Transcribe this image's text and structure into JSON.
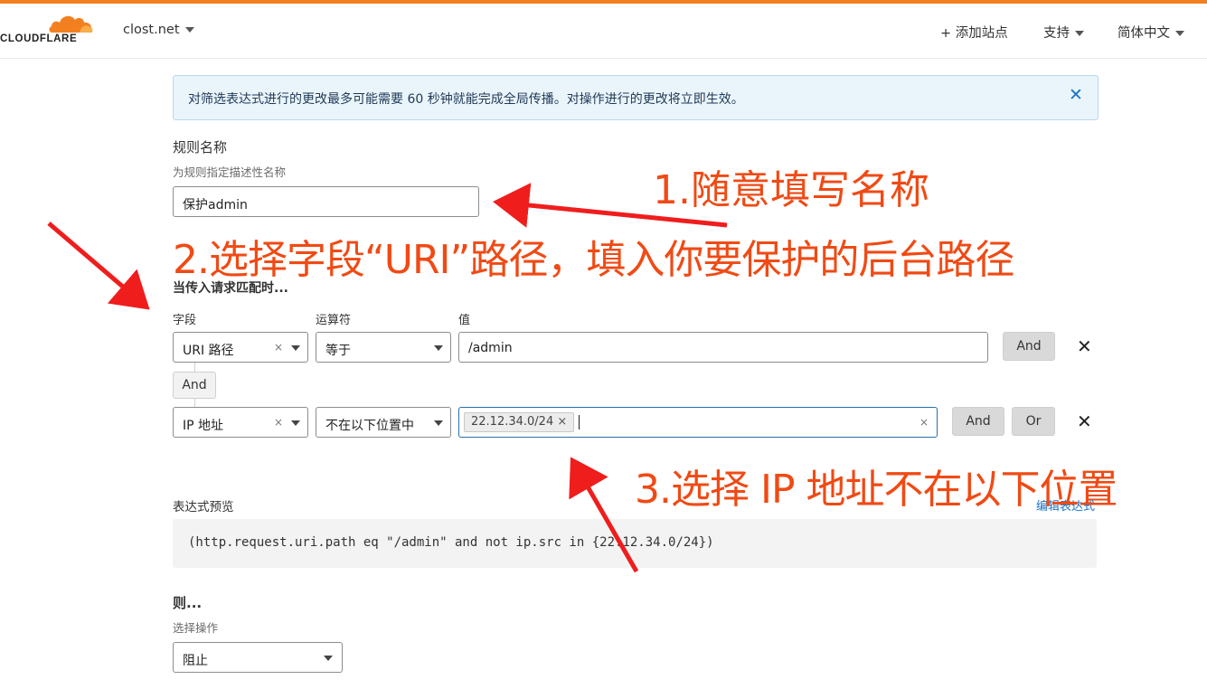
{
  "header": {
    "logo_text": "CLOUDFLARE",
    "domain": "clost.net",
    "add_site": "+ 添加站点",
    "support": "支持",
    "language": "简体中文"
  },
  "notice": {
    "text": "对筛选表达式进行的更改最多可能需要 60 秒钟就能完成全局传播。对操作进行的更改将立即生效。"
  },
  "rule_name": {
    "label": "规则名称",
    "hint": "为规则指定描述性名称",
    "value": "保护admin"
  },
  "match": {
    "heading": "当传入请求匹配时...",
    "field_header": "字段",
    "operator_header": "运算符",
    "value_header": "值",
    "rows": [
      {
        "field": "URI 路径",
        "operator": "等于",
        "value": "/admin",
        "and": "And"
      },
      {
        "field": "IP 地址",
        "operator": "不在以下位置中",
        "chip": "22.12.34.0/24",
        "and": "And",
        "or": "Or"
      }
    ],
    "and_connector": "And"
  },
  "expression": {
    "label": "表达式预览",
    "edit_link": "编辑表达式",
    "text": "(http.request.uri.path eq \"/admin\" and not ip.src in {22.12.34.0/24})"
  },
  "action": {
    "heading": "则...",
    "hint": "选择操作",
    "value": "阻止"
  },
  "annotations": {
    "a1": "1.随意填写名称",
    "a2": "2.选择字段“URI”路径，填入你要保护的后台路径",
    "a3": "3.选择 IP 地址不在以下位置"
  },
  "colors": {
    "accent": "#f38020",
    "annotation": "#f04a14",
    "link": "#1a73c9"
  }
}
